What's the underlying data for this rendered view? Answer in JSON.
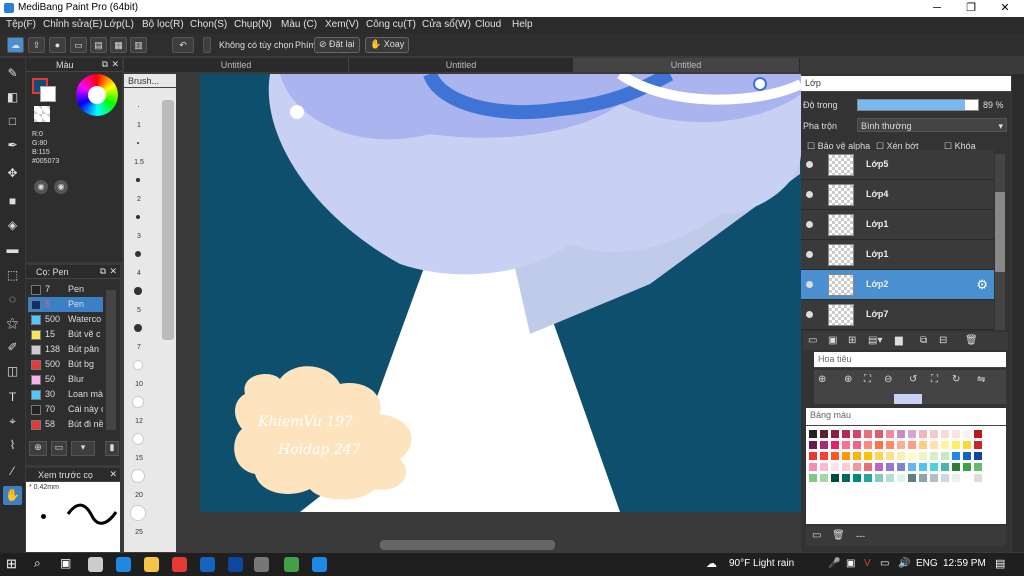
{
  "window": {
    "title": "MediBang Paint Pro (64bit)"
  },
  "menu": [
    "Tệp(F)",
    "Chỉnh sửa(E)",
    "Lớp(L)",
    "Bộ lọc(R)",
    "Chọn(S)",
    "Chụp(N)",
    "Màu (C)",
    "Xem(V)",
    "Công cụ(T)",
    "Cửa sổ(W)",
    "Cloud",
    "Help"
  ],
  "toolbar": {
    "snap_label": "Không có tùy chọn",
    "key_label": "Phím",
    "reset_label": "Đặt lại",
    "rotate_label": "Xoay"
  },
  "tabs": [
    "Untitled",
    "Untitled",
    "Untitled"
  ],
  "color_panel": {
    "title": "Màu",
    "r": "R:0",
    "g": "G:80",
    "b": "B:115",
    "hex": "#005073"
  },
  "brush_panel": {
    "title": "Cọ: Pen",
    "brushes": [
      {
        "size": "7",
        "name": "Pen",
        "color": "#222222"
      },
      {
        "size": "5",
        "name": "Pen",
        "color": "#0f2f6e"
      },
      {
        "size": "500",
        "name": "Waterco",
        "color": "#4fc8ff"
      },
      {
        "size": "15",
        "name": "Bút vẽ c",
        "color": "#f6e75a"
      },
      {
        "size": "138",
        "name": "Bút pân",
        "color": "#cccccc"
      },
      {
        "size": "500",
        "name": "Bút bg",
        "color": "#e53935"
      },
      {
        "size": "50",
        "name": "Blur",
        "color": "#f7b2ef"
      },
      {
        "size": "30",
        "name": "Loan mà",
        "color": "#4fc8ff"
      },
      {
        "size": "70",
        "name": "Cái này c",
        "color": "#222222"
      },
      {
        "size": "58",
        "name": "Bút đi nề",
        "color": "#e53935"
      }
    ]
  },
  "preview_panel": {
    "title": "Xem trước cọ",
    "size": "0.42mm"
  },
  "brush_sizes": [
    "1",
    "1.5",
    "2",
    "3",
    "4",
    "5",
    "7",
    "10",
    "12",
    "15",
    "20",
    "25"
  ],
  "brush_panel_title": "Brush...",
  "layer_panel": {
    "title": "Lớp",
    "opacity_label": "Độ trong",
    "opacity_value": "89 %",
    "opacity_fraction": 0.89,
    "blend_label": "Pha trộn",
    "blend_value": "Bình thường",
    "protect_alpha": "Bảo vệ alpha",
    "clipping": "Xén bớt",
    "lock": "Khóa",
    "layers": [
      "Lớp5",
      "Lớp4",
      "Lớp1",
      "Lớp1",
      "Lớp2",
      "Lớp7"
    ],
    "selected_index": 4
  },
  "navigator_panel": {
    "title": "Hoa tiêu"
  },
  "palette_panel": {
    "title": "Bảng màu",
    "footer": "---"
  },
  "canvas": {
    "text_line1": "KhiemVu 197",
    "text_line2": "Hoidap 247"
  },
  "taskbar": {
    "weather": "90°F  Light rain",
    "lang": "ENG",
    "time": "12:59 PM"
  }
}
